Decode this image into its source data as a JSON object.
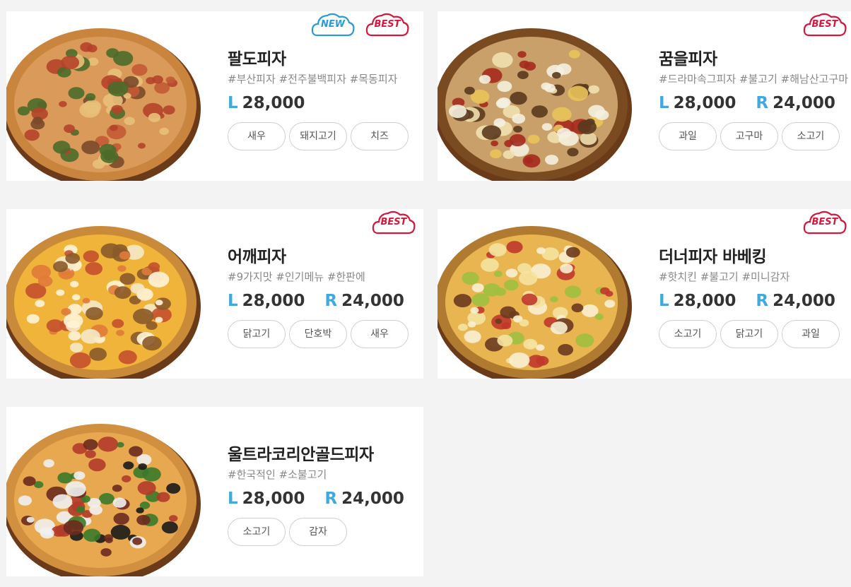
{
  "badge_labels": {
    "new": "NEW",
    "best": "BEST"
  },
  "colors": {
    "accent_size": "#3fa9e0",
    "badge_new": "#2a9bd6",
    "badge_best": "#d4173c",
    "background": "#f3f3f3"
  },
  "products": [
    {
      "name": "팔도피자",
      "tags": "#부산피자 #전주불백피자 #목동피자",
      "prices": [
        {
          "size": "L",
          "amount": "28,000"
        }
      ],
      "toppings": [
        "새우",
        "돼지고기",
        "치즈"
      ],
      "badges": [
        "new",
        "best"
      ],
      "pizza_icon": "pizza-photo"
    },
    {
      "name": "꿈을피자",
      "tags": "#드라마속그피자 #불고기 #해남산고구마",
      "prices": [
        {
          "size": "L",
          "amount": "28,000"
        },
        {
          "size": "R",
          "amount": "24,000"
        }
      ],
      "toppings": [
        "과일",
        "고구마",
        "소고기"
      ],
      "badges": [
        "best"
      ],
      "pizza_icon": "pizza-photo"
    },
    {
      "name": "어깨피자",
      "tags": "#9가지맛 #인기메뉴 #한판에",
      "prices": [
        {
          "size": "L",
          "amount": "28,000"
        },
        {
          "size": "R",
          "amount": "24,000"
        }
      ],
      "toppings": [
        "닭고기",
        "단호박",
        "새우"
      ],
      "badges": [
        "best"
      ],
      "pizza_icon": "pizza-photo"
    },
    {
      "name": "더너피자 바베킹",
      "tags": "#핫치킨 #불고기 #미니감자",
      "prices": [
        {
          "size": "L",
          "amount": "28,000"
        },
        {
          "size": "R",
          "amount": "24,000"
        }
      ],
      "toppings": [
        "소고기",
        "닭고기",
        "과일"
      ],
      "badges": [
        "best"
      ],
      "pizza_icon": "pizza-photo"
    },
    {
      "name": "울트라코리안골드피자",
      "tags": "#한국적인 #소불고기",
      "prices": [
        {
          "size": "L",
          "amount": "28,000"
        },
        {
          "size": "R",
          "amount": "24,000"
        }
      ],
      "toppings": [
        "소고기",
        "감자"
      ],
      "badges": [],
      "pizza_icon": "pizza-photo"
    }
  ]
}
